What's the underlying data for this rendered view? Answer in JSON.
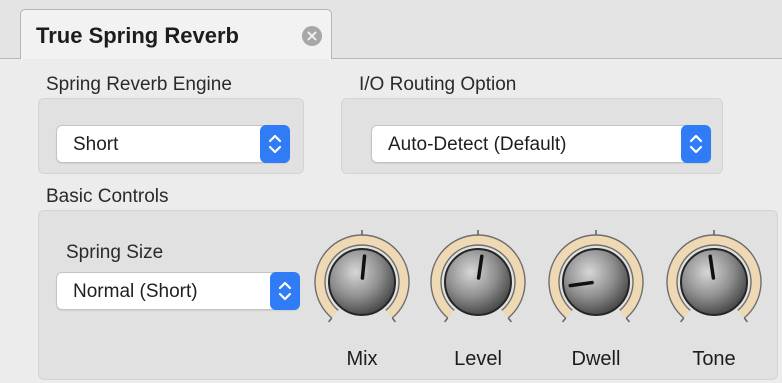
{
  "tab": {
    "title": "True Spring Reverb",
    "close_icon": "close-circle-icon"
  },
  "engine": {
    "label": "Spring Reverb Engine",
    "value": "Short"
  },
  "routing": {
    "label": "I/O Routing Option",
    "value": "Auto-Detect (Default)"
  },
  "basic": {
    "label": "Basic Controls",
    "spring_size_label": "Spring Size",
    "spring_size_value": "Normal (Short)"
  },
  "knobs": [
    {
      "label": "Mix",
      "level": 0.52
    },
    {
      "label": "Level",
      "level": 0.53
    },
    {
      "label": "Dwell",
      "level": 0.15
    },
    {
      "label": "Tone",
      "level": 0.47
    }
  ],
  "colors": {
    "accent": "#2f7cf6",
    "knob_ring": "#efd9b4"
  }
}
